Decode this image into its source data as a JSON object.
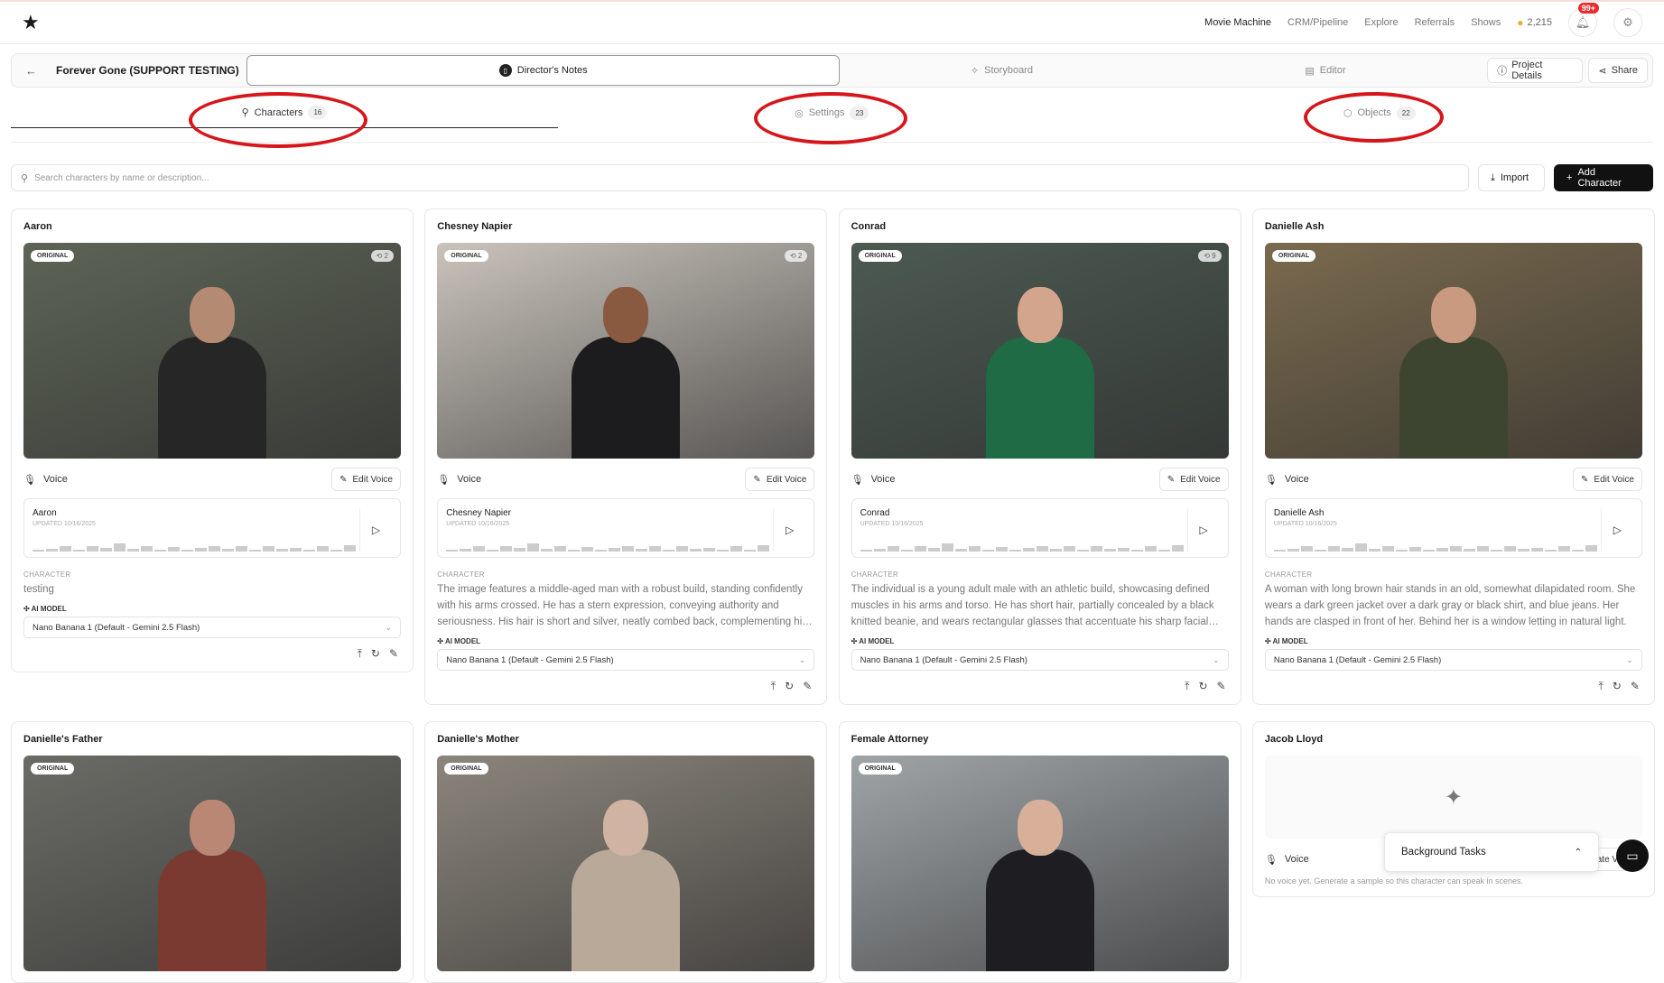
{
  "nav": {
    "links": [
      "Movie Machine",
      "CRM/Pipeline",
      "Explore",
      "Referrals",
      "Shows"
    ],
    "credits": "2,215",
    "notifications_badge": "99+"
  },
  "project": {
    "title": "Forever Gone (SUPPORT TESTING)",
    "tabs": [
      "Director's Notes",
      "Storyboard",
      "Editor"
    ],
    "details_label": "Project Details",
    "share_label": "Share"
  },
  "asset_tabs": [
    {
      "label": "Characters",
      "count": "16"
    },
    {
      "label": "Settings",
      "count": "23"
    },
    {
      "label": "Objects",
      "count": "22"
    }
  ],
  "search": {
    "placeholder": "Search characters by name or description..."
  },
  "import_label": "Import",
  "add_label": "Add Character",
  "labels": {
    "original": "ORIGINAL",
    "voice": "Voice",
    "edit_voice": "Edit Voice",
    "character": "CHARACTER",
    "ai_model": "AI MODEL",
    "create_voice": "Create Voice",
    "no_voice": "No voice yet. Generate a sample so this character can speak in scenes."
  },
  "cards": [
    {
      "name": "Aaron",
      "versions": "2",
      "voice_name": "Aaron",
      "updated": "UPDATED 10/16/2025",
      "description": "testing",
      "model": "Nano Banana 1 (Default - Gemini 2.5 Flash)",
      "bg": "#5d6456",
      "skin": "#b48a72",
      "cloth": "#262626"
    },
    {
      "name": "Chesney Napier",
      "versions": "2",
      "voice_name": "Chesney Napier",
      "updated": "UPDATED 10/16/2025",
      "description": "The image features a middle-aged man with a robust build, standing confidently with his arms crossed. He has a stern expression, conveying authority and seriousness. His hair is short and silver, neatly combed back, complementing his appearance.",
      "model": "Nano Banana 1 (Default - Gemini 2.5 Flash)",
      "bg": "#c9c3bb",
      "skin": "#8a5a40",
      "cloth": "#1c1c1f"
    },
    {
      "name": "Conrad",
      "versions": "9",
      "voice_name": "Conrad",
      "updated": "UPDATED 10/16/2025",
      "description": "The individual is a young adult male with an athletic build, showcasing defined muscles in his arms and torso. He has short hair, partially concealed by a black knitted beanie, and wears rectangular glasses that accentuate his sharp facial features.",
      "model": "Nano Banana 1 (Default - Gemini 2.5 Flash)",
      "bg": "#4c5a52",
      "skin": "#d2a58c",
      "cloth": "#1f6b45"
    },
    {
      "name": "Danielle Ash",
      "versions": "",
      "voice_name": "Danielle Ash",
      "updated": "UPDATED 10/16/2025",
      "description": "A woman with long brown hair stands in an old, somewhat dilapidated room. She wears a dark green jacket over a dark gray or black shirt, and blue jeans. Her hands are clasped in front of her. Behind her is a window letting in natural light.",
      "model": "Nano Banana 1 (Default - Gemini 2.5 Flash)",
      "bg": "#7a6a4e",
      "skin": "#c99a80",
      "cloth": "#3d4430"
    },
    {
      "name": "Danielle's Father",
      "bg": "#6b6b66",
      "skin": "#b98774",
      "cloth": "#7a3a32"
    },
    {
      "name": "Danielle's Mother",
      "bg": "#8b857c",
      "skin": "#d0b3a3",
      "cloth": "#b9a999"
    },
    {
      "name": "Female Attorney",
      "bg": "#9fa4a6",
      "skin": "#d8b09a",
      "cloth": "#1d1d22"
    },
    {
      "name": "Jacob Lloyd",
      "empty": true
    }
  ],
  "background_tasks": "Background Tasks"
}
